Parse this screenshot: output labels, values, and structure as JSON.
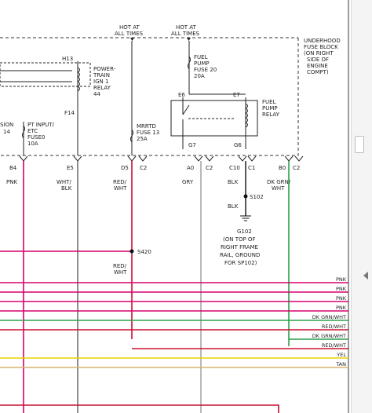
{
  "labels": {
    "hot_at_1": "HOT AT",
    "all_times_1": "ALL TIMES",
    "hot_at_2": "HOT AT",
    "all_times_2": "ALL TIMES",
    "fuse_block_1": "UNDERHOOD",
    "fuse_block_2": "FUSE BLOCK",
    "fuse_block_3": "(ON RIGHT",
    "fuse_block_4": "SIDE OF",
    "fuse_block_5": "ENGINE",
    "fuse_block_6": "COMPT)",
    "h13": "H13",
    "f14": "F14",
    "pt_relay_1": "POWER-",
    "pt_relay_2": "TRAIN",
    "pt_relay_3": "IGN 1",
    "pt_relay_4": "RELAY",
    "pt_relay_5": "44",
    "fuel_fuse_1": "FUEL",
    "fuel_fuse_2": "PUMP",
    "fuel_fuse_3": "FUSE 20",
    "fuel_fuse_4": "20A",
    "e6": "E6",
    "e7": "E7",
    "fp_relay_1": "FUEL",
    "fp_relay_2": "PUMP",
    "fp_relay_3": "RELAY",
    "g7": "G7",
    "g6": "G6",
    "sion": "SION",
    "sion_14": "14",
    "ptinput_1": "PT INPUT/",
    "ptinput_2": "ETC",
    "ptinput_3": "FUSE0",
    "ptinput_4": "10A",
    "mrrtd_1": "MRRTD",
    "mrrtd_2": "FUSE 13",
    "mrrtd_3": "25A",
    "pins": [
      "B4",
      "E5",
      "D5",
      "C2",
      "A0",
      "C2",
      "C10",
      "C1",
      "B0",
      "C2"
    ],
    "pnk": "PNK",
    "wht_blk_1": "WHT/",
    "wht_blk_2": "BLK",
    "red_wht_1": "RED/",
    "red_wht_2": "WHT",
    "gry": "GRY",
    "blk1": "BLK",
    "dkgrn_1": "DK GRN/",
    "dkgrn_2": "WHT",
    "s102": "S102",
    "blk2": "BLK",
    "g102_1": "G102",
    "g102_2": "(ON TOP OF",
    "g102_3": "RIGHT FRAME",
    "g102_4": "RAIL, GROUND",
    "g102_5": "FOR SP102)",
    "s420": "S420",
    "red_wht_3": "RED/",
    "red_wht_4": "WHT"
  },
  "bus_wires": [
    {
      "label": "PNK",
      "color": "#d6006f"
    },
    {
      "label": "PNK",
      "color": "#d6006f"
    },
    {
      "label": "PNK",
      "color": "#d6006f"
    },
    {
      "label": "PNK",
      "color": "#d6006f"
    },
    {
      "label": "DK GRN/WHT",
      "color": "#2ba24c"
    },
    {
      "label": "RED/WHT",
      "color": "#c8102e"
    },
    {
      "label": "DK GRN/WHT",
      "color": "#2ba24c"
    },
    {
      "label": "RED/WHT",
      "color": "#c8102e"
    },
    {
      "label": "YEL",
      "color": "#e6d200"
    },
    {
      "label": "TAN",
      "color": "#d8b46e"
    }
  ],
  "colors": {
    "pnk": "#d6006f",
    "red": "#c8102e",
    "green": "#2ba24c",
    "gray": "#9a9a9a",
    "black": "#111111",
    "ink": "#222222"
  }
}
